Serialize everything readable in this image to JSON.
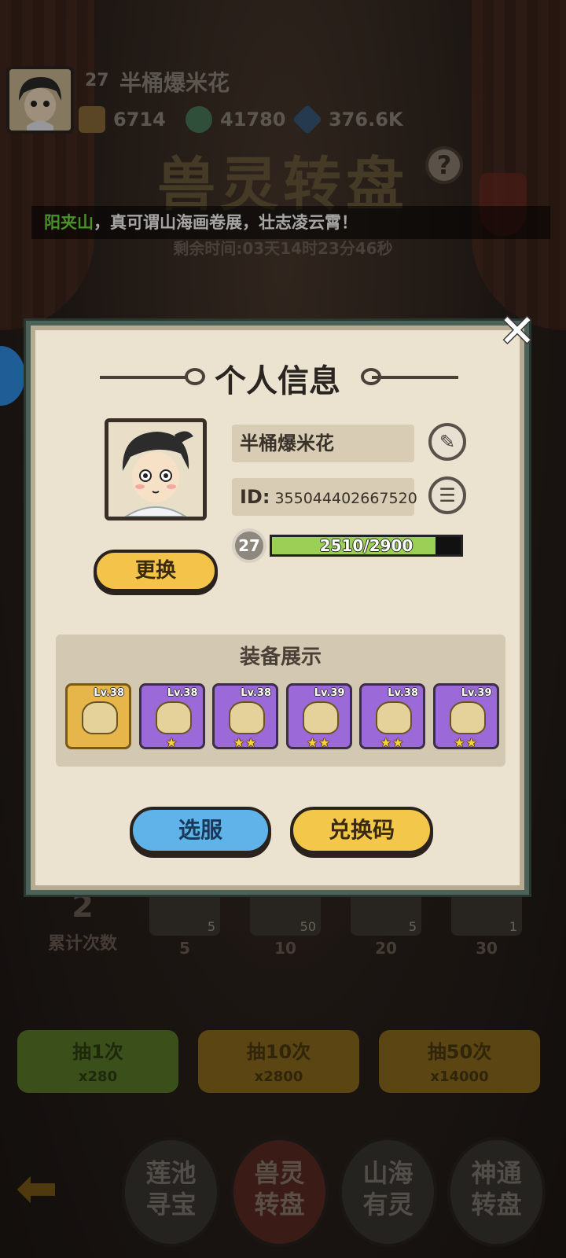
{
  "player": {
    "level": "27",
    "name": "半桶爆米花",
    "id_label": "ID:",
    "id_value": "355044402667520",
    "exp_text": "2510/2900",
    "exp_fraction": 0.8655
  },
  "resources": [
    {
      "icon": "food-basket-icon",
      "value": "6714"
    },
    {
      "icon": "spirit-coin-icon",
      "value": "41780"
    },
    {
      "icon": "blue-crystal-icon",
      "value": "376.6K"
    }
  ],
  "background": {
    "title": "兽灵转盘",
    "help": "?",
    "marquee_highlight": "阳夹山",
    "marquee_text": "，真可谓山海画卷展，壮志凌云霄！",
    "remaining_time": "剩余时间:03天14时23分46秒",
    "total_count": "2",
    "total_count_label": "累计次数",
    "milestones": [
      {
        "qty": "5",
        "threshold": "5"
      },
      {
        "qty": "50",
        "threshold": "10"
      },
      {
        "qty": "5",
        "threshold": "20"
      },
      {
        "qty": "1",
        "threshold": "30"
      }
    ],
    "draw_buttons": [
      {
        "label": "抽1次",
        "cost": "x280"
      },
      {
        "label": "抽10次",
        "cost": "x2800"
      },
      {
        "label": "抽50次",
        "cost": "x14000"
      }
    ],
    "nav": [
      {
        "label": "莲池\n寻宝"
      },
      {
        "label": "兽灵\n转盘"
      },
      {
        "label": "山海\n有灵"
      },
      {
        "label": "神通\n转盘"
      }
    ]
  },
  "modal": {
    "title": "个人信息",
    "close": "✕",
    "change_button": "更换",
    "equip_title": "装备展示",
    "server_button": "选服",
    "redeem_button": "兑换码"
  },
  "equipment": [
    {
      "level": "Lv.38",
      "rarity": "gold",
      "stars": ""
    },
    {
      "level": "Lv.38",
      "rarity": "purple",
      "stars": "★"
    },
    {
      "level": "Lv.38",
      "rarity": "purple",
      "stars": "★★"
    },
    {
      "level": "Lv.39",
      "rarity": "purple",
      "stars": "★★"
    },
    {
      "level": "Lv.38",
      "rarity": "purple",
      "stars": "★★"
    },
    {
      "level": "Lv.39",
      "rarity": "purple",
      "stars": "★★"
    }
  ]
}
